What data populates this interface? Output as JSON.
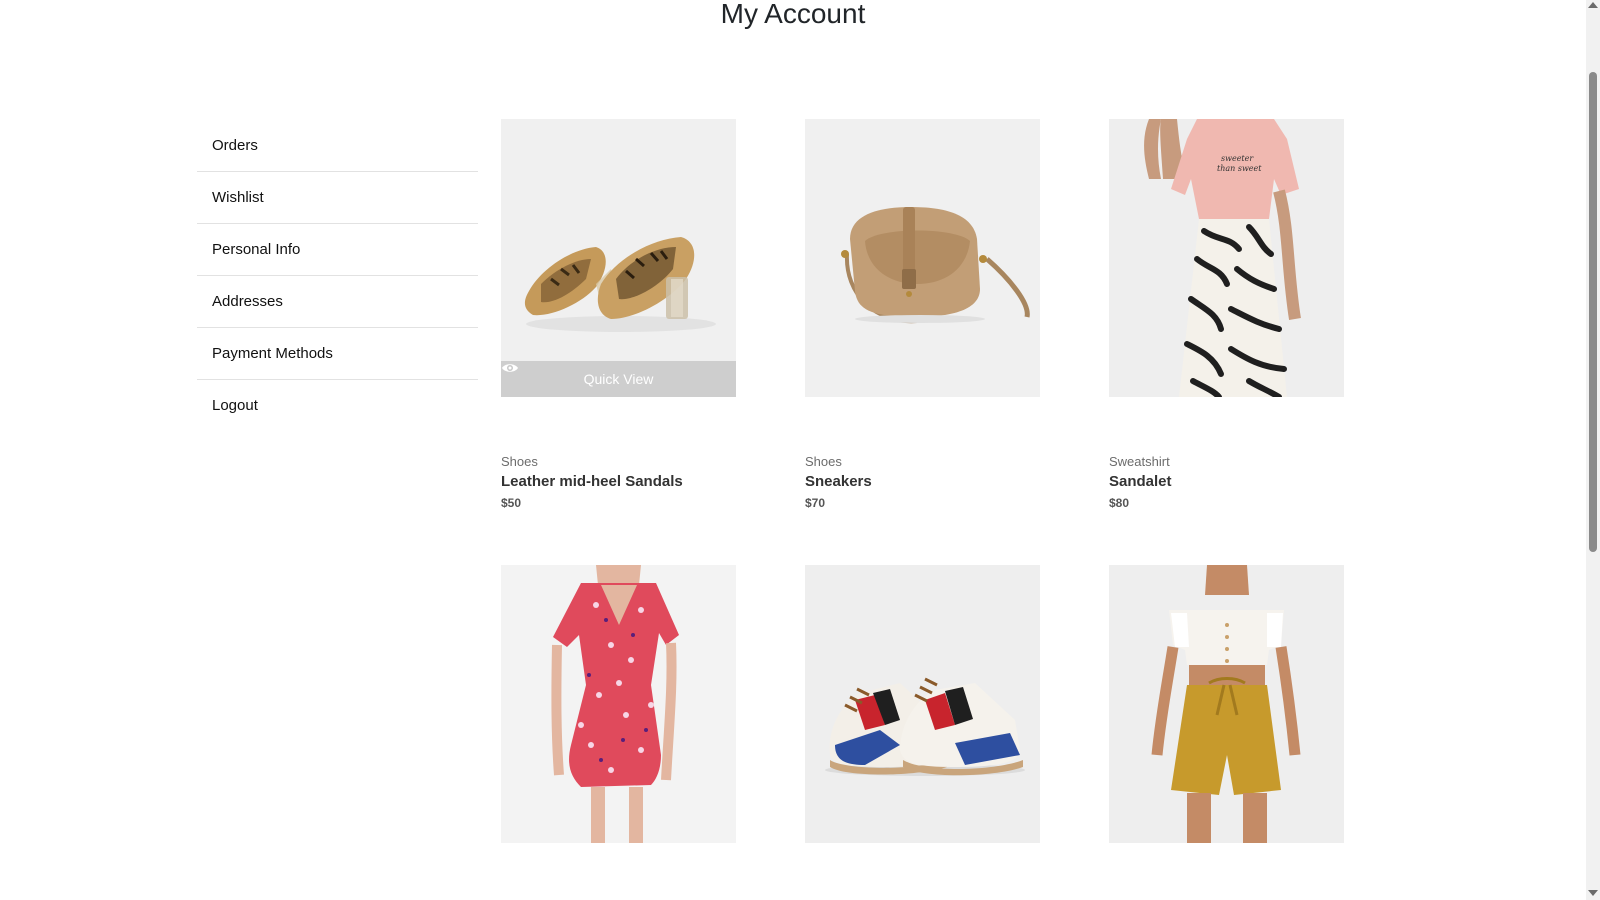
{
  "page": {
    "title": "My Account"
  },
  "sidebar": {
    "items": [
      {
        "label": "Orders"
      },
      {
        "label": "Wishlist"
      },
      {
        "label": "Personal Info"
      },
      {
        "label": "Addresses"
      },
      {
        "label": "Payment Methods"
      },
      {
        "label": "Logout"
      }
    ]
  },
  "products": [
    {
      "category": "Shoes",
      "name": "Leather mid-heel Sandals",
      "price": "$50",
      "image": "sandals-image",
      "quick_view_label": "Quick View"
    },
    {
      "category": "Shoes",
      "name": "Sneakers",
      "price": "$70",
      "image": "handbag-image"
    },
    {
      "category": "Sweatshirt",
      "name": "Sandalet",
      "price": "$80",
      "image": "tshirt-skirt-model-image"
    },
    {
      "category": "",
      "name": "",
      "price": "",
      "image": "floral-dress-model-image"
    },
    {
      "category": "",
      "name": "",
      "price": "",
      "image": "sneakers-image"
    },
    {
      "category": "",
      "name": "",
      "price": "",
      "image": "offshoulder-shorts-model-image"
    }
  ],
  "colors": {
    "image_bg": "#f1f1f1",
    "quick_view_bg": "#c8c8c8"
  }
}
